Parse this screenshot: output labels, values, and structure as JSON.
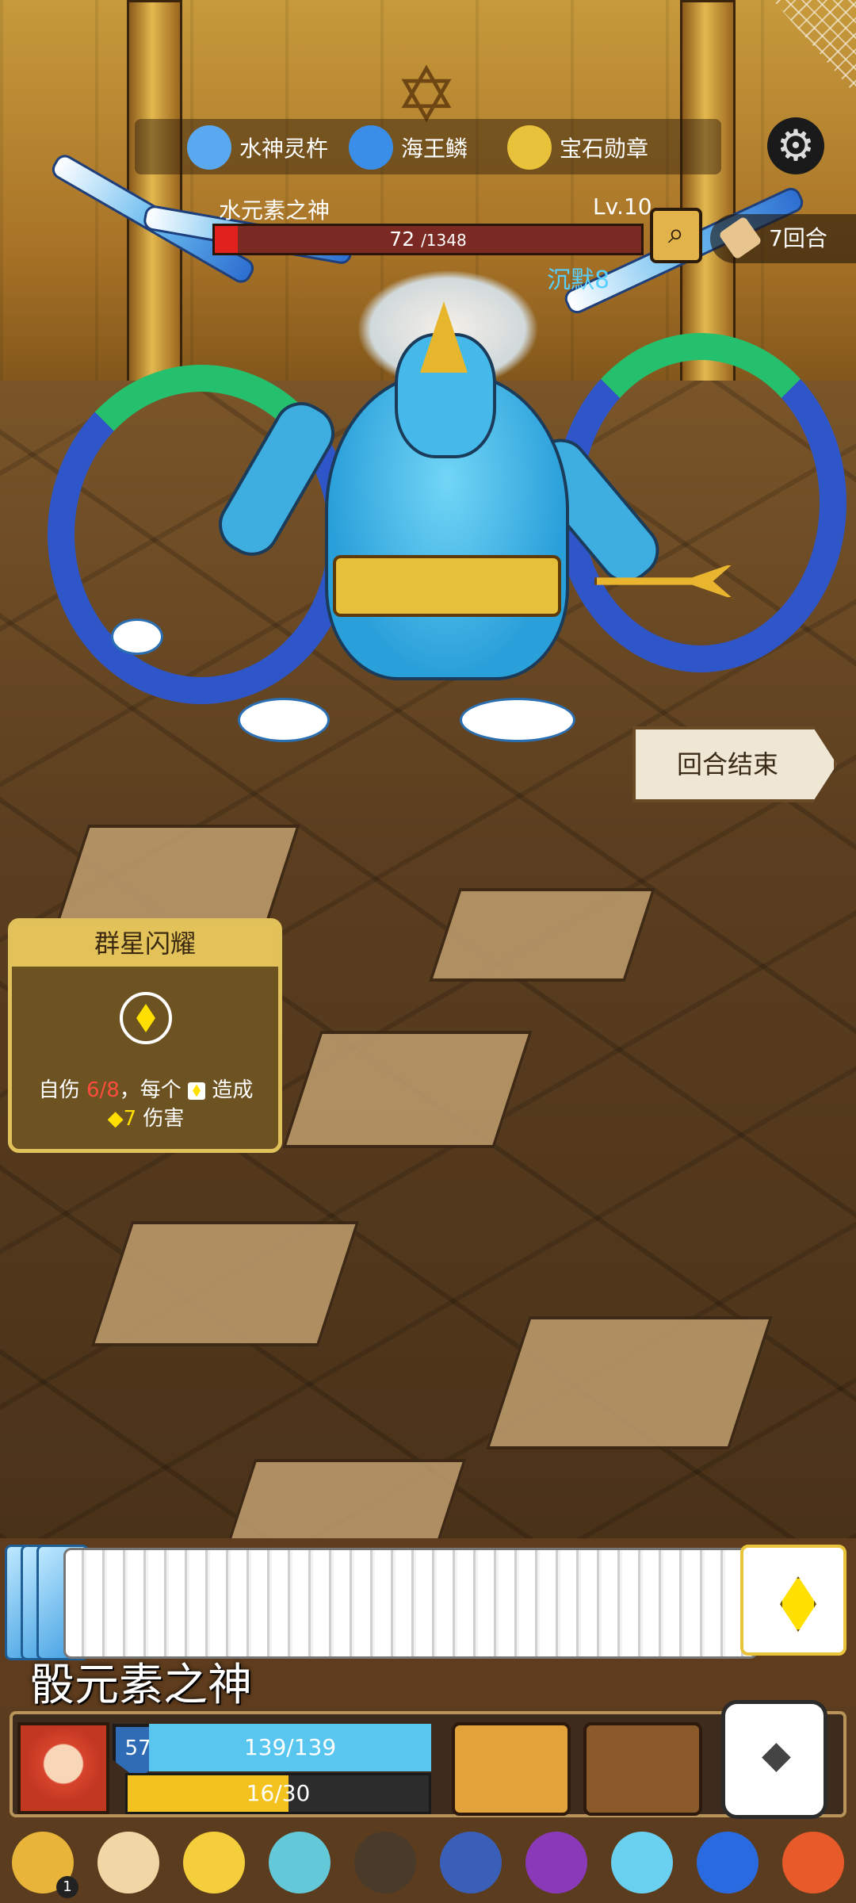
{
  "relics": [
    {
      "name": "水神灵杵",
      "icon": "water-scepter-icon",
      "color": "#5aa9f0"
    },
    {
      "name": "海王鳞",
      "icon": "sea-scale-icon",
      "color": "#3a8ee8"
    },
    {
      "name": "宝石勋章",
      "icon": "gem-medal-icon",
      "color": "#e8c23a"
    }
  ],
  "boss": {
    "name": "水元素之神",
    "level": "Lv.10",
    "hp_current": "72",
    "hp_max": "/1348",
    "hp_fraction": 0.0534,
    "status": "沉默8"
  },
  "turn_counter": "7回合",
  "end_turn_label": "回合结束",
  "card": {
    "title": "群星闪耀",
    "desc_1": "自伤",
    "desc_self_damage": "6/8",
    "desc_2": "，每个",
    "desc_3": "造成",
    "desc_dmg": "7",
    "desc_4": "伤害"
  },
  "deck_label": "骰元素之神",
  "player": {
    "armor": "57",
    "hp": "139/139",
    "energy": "16/30",
    "energy_fraction": 0.533
  },
  "colors": {
    "hp_red": "#e0211c",
    "player_hp_blue": "#59c6ef",
    "energy_yellow": "#f4c21e",
    "gem_yellow": "#ffe000"
  },
  "inventory": [
    {
      "icon": "gold-sack-icon",
      "badge": "1"
    },
    {
      "icon": "eye-orb-icon"
    },
    {
      "icon": "golden-crown-icon"
    },
    {
      "icon": "blue-slime-icon"
    },
    {
      "icon": "dark-claw-icon"
    },
    {
      "icon": "hexagram-icon"
    },
    {
      "icon": "purple-cloak-icon"
    },
    {
      "icon": "ice-crystal-icon"
    },
    {
      "icon": "blue-flame-icon"
    },
    {
      "icon": "meat-leg-icon"
    }
  ]
}
